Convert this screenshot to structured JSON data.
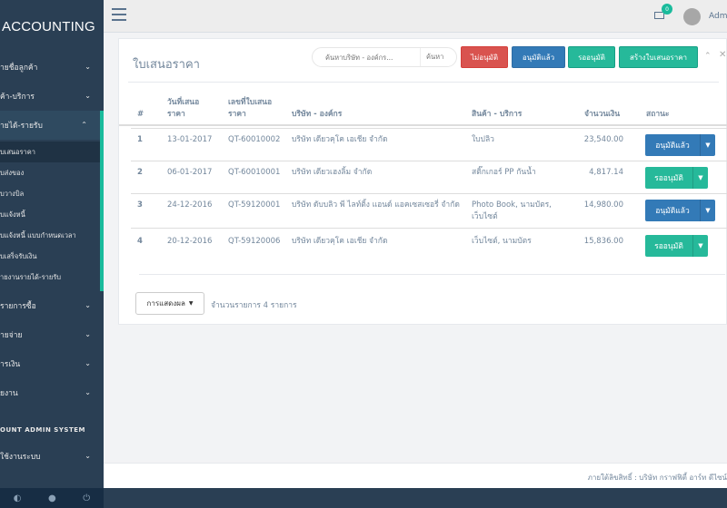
{
  "brand": "ACCOUNTING",
  "sidebar": {
    "items": [
      {
        "label": "ายชื่อลูกค้า"
      },
      {
        "label": "ค้า-บริการ"
      },
      {
        "label": "ายได้-รายรับ"
      }
    ],
    "sub_items": [
      {
        "label": "บเสนอราคา"
      },
      {
        "label": "บส่งของ"
      },
      {
        "label": "บวางบิล"
      },
      {
        "label": "บแจ้งหนี้"
      },
      {
        "label": "บแจ้งหนี้ แบบกำหนดเวลา"
      },
      {
        "label": "บเสร็จรับเงิน"
      },
      {
        "label": "ายงานรายได้-รายรับ"
      }
    ],
    "items2": [
      {
        "label": "รายการซื้อ"
      },
      {
        "label": "ายจ่าย"
      },
      {
        "label": "ารเงิน"
      },
      {
        "label": "ยงาน"
      }
    ],
    "section_title": "OUNT ADMIN SYSTEM",
    "items3": [
      {
        "label": "ใช้งานระบบ"
      }
    ]
  },
  "topbar": {
    "badge": "0",
    "admin_name": "Admin"
  },
  "panel": {
    "title": "ใบเสนอราคา",
    "search_placeholder": "ค้นหาบริษัท - องค์กร...",
    "search_button": "ค้นหา",
    "btn_rejected": "ไม่อนุมัติ",
    "btn_approved": "อนุมัติแล้ว",
    "btn_pending": "รออนุมัติ",
    "btn_create": "สร้างใบเสนอราคา"
  },
  "table": {
    "headers": {
      "num": "#",
      "date": "วันที่เสนอ\nราคา",
      "doc": "เลขที่ใบเสนอ\nราคา",
      "company": "บริษัท - องค์กร",
      "product": "สินค้า - บริการ",
      "amount": "จำนวนเงิน",
      "status": "สถานะ"
    },
    "rows": [
      {
        "num": "1",
        "date": "13-01-2017",
        "doc": "QT-60010002",
        "company": "บริษัท เดียวคุโค เอเชีย จำกัด",
        "product": "ใบปลิว",
        "amount": "23,540.00",
        "status": "อนุมัติแล้ว"
      },
      {
        "num": "2",
        "date": "06-01-2017",
        "doc": "QT-60010001",
        "company": "บริษัท เดียวเฮงลิ้ม จำกัด",
        "product": "สติ๊กเกอร์ PP กันน้ำ",
        "amount": "4,817.14",
        "status": "รออนุมัติ"
      },
      {
        "num": "3",
        "date": "24-12-2016",
        "doc": "QT-59120001",
        "company": "บริษัท ดับบลิว พี ไลท์ติ้ง แอนด์ แอคเซสเซอรี่ จำกัด",
        "product": "Photo Book, นามบัตร, เว็บไซต์",
        "amount": "14,980.00",
        "status": "อนุมัติแล้ว"
      },
      {
        "num": "4",
        "date": "20-12-2016",
        "doc": "QT-59120006",
        "company": "บริษัท เดียวคุโค เอเชีย จำกัด",
        "product": "เว็บไซต์, นามบัตร",
        "amount": "15,836.00",
        "status": "รออนุมัติ"
      }
    ]
  },
  "display_button": "การแสดงผล",
  "count_text": "จำนวนรายการ 4 รายการ",
  "footer": "ภายใต้ลิขสิทธิ์ : บริษัท กราฟฟิตี้ อาร์ท ดีไซน์"
}
